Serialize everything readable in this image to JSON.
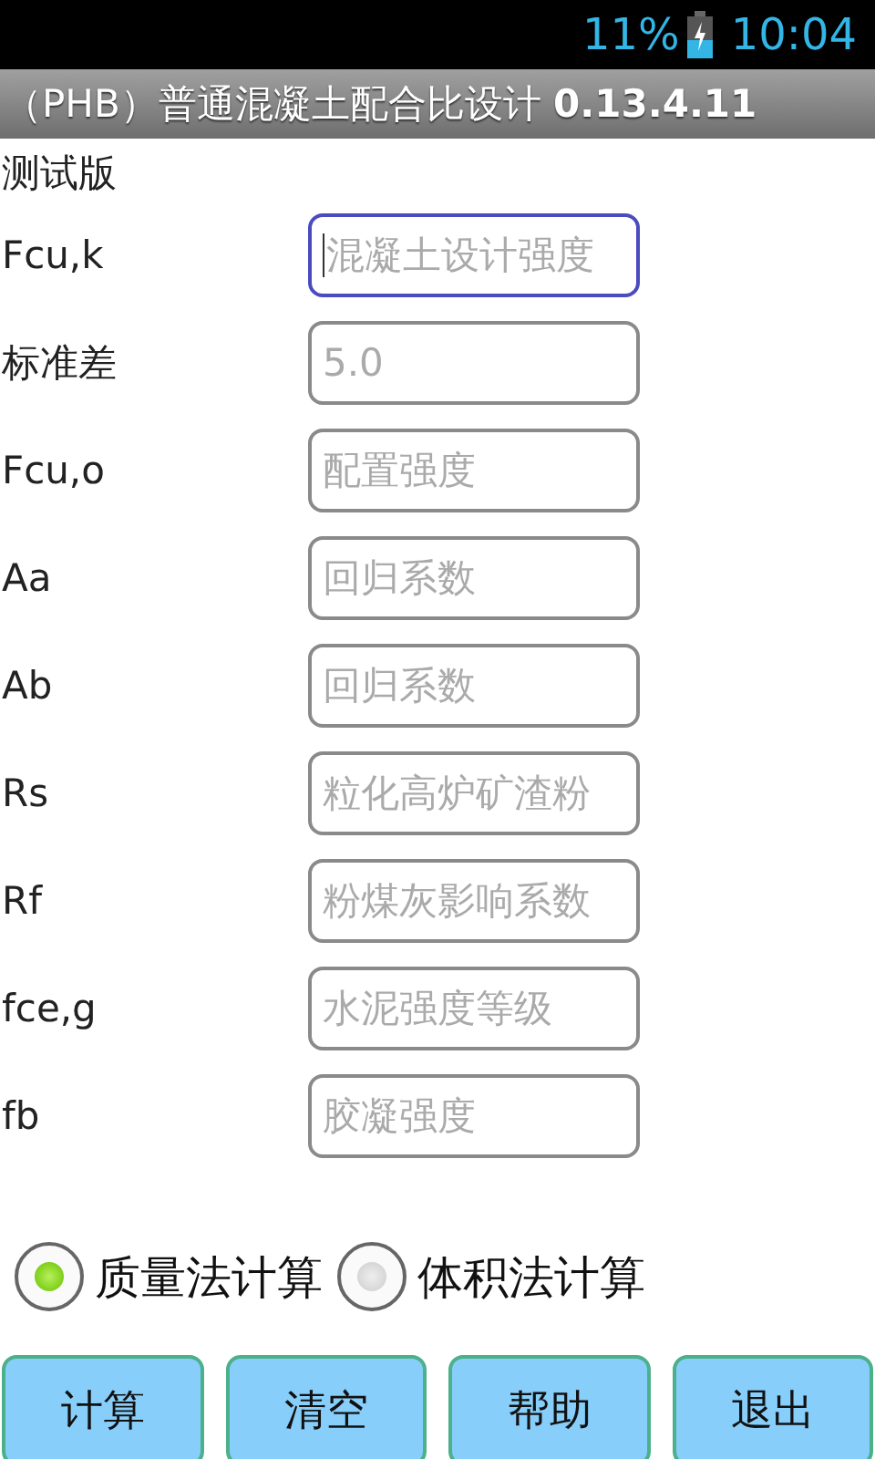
{
  "status_bar": {
    "battery_text": "11%",
    "time": "10:04"
  },
  "title_bar": {
    "title": "（PHB）普通混凝土配合比设计 ",
    "version": "0.13.4.11"
  },
  "subtitle": "测试版",
  "fields": [
    {
      "label": "Fcu,k",
      "placeholder": "混凝土设计强度",
      "focused": true
    },
    {
      "label": "标准差",
      "placeholder": "5.0",
      "focused": false
    },
    {
      "label": "Fcu,o",
      "placeholder": "配置强度",
      "focused": false
    },
    {
      "label": "Aa",
      "placeholder": "回归系数",
      "focused": false
    },
    {
      "label": "Ab",
      "placeholder": "回归系数",
      "focused": false
    },
    {
      "label": "Rs",
      "placeholder": "粒化高炉矿渣粉",
      "focused": false
    },
    {
      "label": "Rf",
      "placeholder": "粉煤灰影响系数",
      "focused": false
    },
    {
      "label": "fce,g",
      "placeholder": "水泥强度等级",
      "focused": false
    },
    {
      "label": "fb",
      "placeholder": "胶凝强度",
      "focused": false
    }
  ],
  "methods": [
    {
      "label": "质量法计算",
      "selected": true
    },
    {
      "label": "体积法计算",
      "selected": false
    }
  ],
  "buttons": [
    "计算",
    "清空",
    "帮助",
    "退出"
  ]
}
